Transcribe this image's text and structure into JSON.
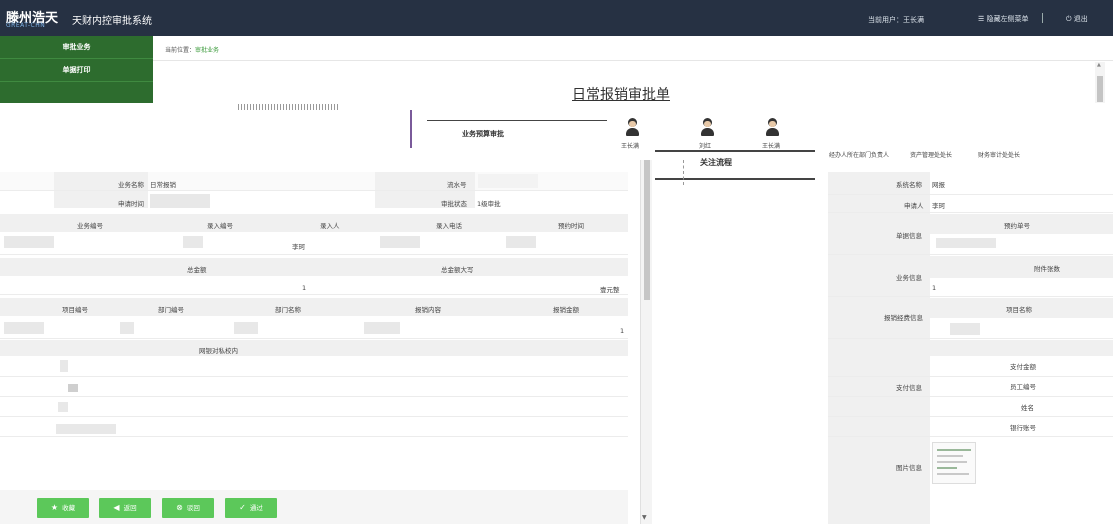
{
  "header": {
    "logo_cn": "滕州浩天",
    "logo_en": "GREAT-CHN",
    "system_title": "天财内控审批系统",
    "current_user": "当前用户：王长满",
    "collapse_menu": "隐藏左侧菜单",
    "exit": "退出"
  },
  "sidebar": {
    "items": [
      {
        "label": "审批业务"
      },
      {
        "label": "单据打印"
      }
    ]
  },
  "breadcrumb": {
    "prefix": "当前位置：",
    "current": "审批业务"
  },
  "document": {
    "title": "日常报销审批单"
  },
  "flow": {
    "current_step": "业务预算审批",
    "persons": [
      {
        "name": "王长满"
      },
      {
        "name": "刘红"
      },
      {
        "name": "王长满"
      }
    ],
    "roles": [
      "经办人所在部门负责人",
      "资产管理处处长",
      "财务审计处处长"
    ],
    "side_label": "关注流程"
  },
  "form": {
    "business_name_label": "业务名称",
    "business_name_value": "日常报销",
    "serial_label": "流水号",
    "apply_time_label": "申请时间",
    "status_label": "审批状态",
    "status_value": "1级审批",
    "columns1": [
      "业务编号",
      "录入编号",
      "录入人",
      "录入电话",
      "预约时间"
    ],
    "entry_person": "李珂",
    "total_label": "总金额",
    "total_upper_label": "总金额大写",
    "total_value": "1",
    "total_upper_value": "壹元整",
    "columns2": [
      "项目编号",
      "部门编号",
      "部门名称",
      "报销内容",
      "报销金额"
    ],
    "reimburse_amount": "1",
    "transfer_label": "网银对私校内"
  },
  "right": {
    "system_name_label": "系统名称",
    "system_name_value": "网报",
    "applicant_label": "申请人",
    "applicant_value": "李珂",
    "doc_info_label": "单据信息",
    "appointment_no_label": "预约单号",
    "business_info_label": "业务信息",
    "attachment_label": "附件张数",
    "attachment_value": "1",
    "expense_info_label": "报销经费信息",
    "project_name_label": "项目名称",
    "payment_info_label": "支付信息",
    "payment_fields": [
      "支付金额",
      "员工编号",
      "姓名",
      "银行账号"
    ],
    "image_info_label": "图片信息"
  },
  "buttons": {
    "favorite": "收藏",
    "back": "返回",
    "reject": "驳回",
    "pass": "通过"
  },
  "colors": {
    "topbar": "#263143",
    "sidebar": "#2d6c2e",
    "button": "#5cc85a"
  }
}
